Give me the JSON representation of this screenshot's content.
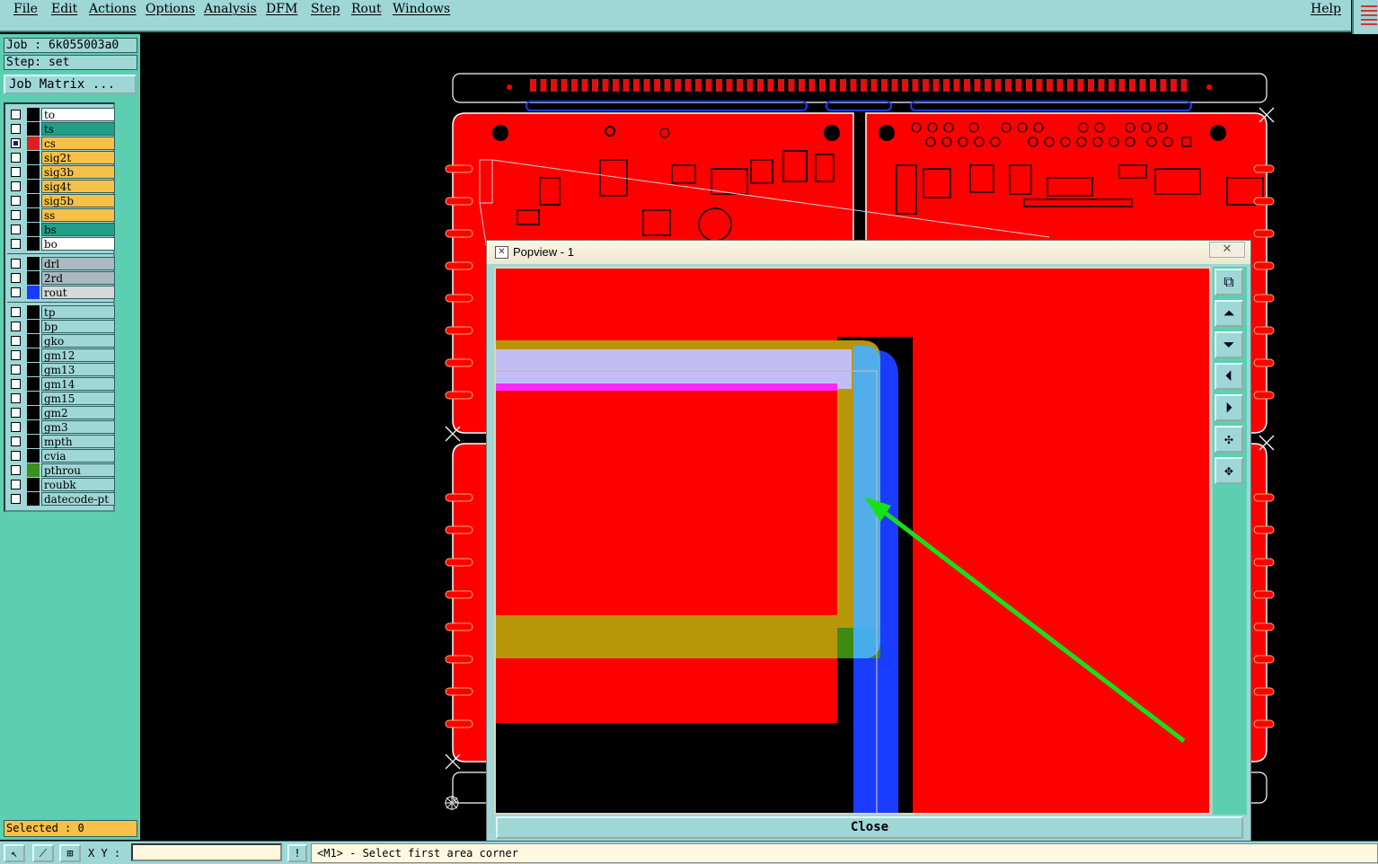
{
  "menu": {
    "items": [
      "File",
      "Edit",
      "Actions",
      "Options",
      "Analysis",
      "DFM",
      "Step",
      "Rout",
      "Windows"
    ],
    "help": "Help"
  },
  "left_panel": {
    "job": "Job : 6k055003a0",
    "step": "Step: set",
    "job_matrix_button": "Job Matrix ...",
    "selected": "Selected : 0",
    "layers_group1": [
      {
        "name": "to",
        "color": "#ffffff",
        "swatch": "#000000"
      },
      {
        "name": "ts",
        "color": "#20a088",
        "swatch": "#000000"
      },
      {
        "name": "cs",
        "color": "#f7c046",
        "swatch": "#e02020",
        "active": true
      },
      {
        "name": "sig2t",
        "color": "#f7c046",
        "swatch": "#000000"
      },
      {
        "name": "sig3b",
        "color": "#f7c046",
        "swatch": "#000000"
      },
      {
        "name": "sig4t",
        "color": "#f7c046",
        "swatch": "#000000"
      },
      {
        "name": "sig5b",
        "color": "#f7c046",
        "swatch": "#000000"
      },
      {
        "name": "ss",
        "color": "#f7c046",
        "swatch": "#000000"
      },
      {
        "name": "bs",
        "color": "#20a088",
        "swatch": "#000000"
      },
      {
        "name": "bo",
        "color": "#ffffff",
        "swatch": "#000000"
      }
    ],
    "layers_group2": [
      {
        "name": "drl",
        "color": "#aab8c0",
        "swatch": "#000000"
      },
      {
        "name": "2rd",
        "color": "#aab8c0",
        "swatch": "#000000"
      },
      {
        "name": "rout",
        "color": "#d8d8d8",
        "swatch": "#1a3cff"
      }
    ],
    "layers_group3": [
      {
        "name": "tp",
        "color": "#9fd6d6",
        "swatch": "#000000"
      },
      {
        "name": "bp",
        "color": "#9fd6d6",
        "swatch": "#000000"
      },
      {
        "name": "gko",
        "color": "#9fd6d6",
        "swatch": "#000000"
      },
      {
        "name": "gm12",
        "color": "#9fd6d6",
        "swatch": "#000000"
      },
      {
        "name": "gm13",
        "color": "#9fd6d6",
        "swatch": "#000000"
      },
      {
        "name": "gm14",
        "color": "#9fd6d6",
        "swatch": "#000000"
      },
      {
        "name": "gm15",
        "color": "#9fd6d6",
        "swatch": "#000000"
      },
      {
        "name": "gm2",
        "color": "#9fd6d6",
        "swatch": "#000000"
      },
      {
        "name": "gm3",
        "color": "#9fd6d6",
        "swatch": "#000000"
      },
      {
        "name": "mpth",
        "color": "#9fd6d6",
        "swatch": "#000000"
      },
      {
        "name": "cvia",
        "color": "#9fd6d6",
        "swatch": "#000000"
      },
      {
        "name": "pthrou",
        "color": "#9fd6d6",
        "swatch": "#3a8f20"
      },
      {
        "name": "roubk",
        "color": "#9fd6d6",
        "swatch": "#000000"
      },
      {
        "name": "datecode-pt",
        "color": "#9fd6d6",
        "swatch": "#000000"
      }
    ]
  },
  "popview": {
    "title": "Popview - 1",
    "close_label": "Close",
    "close_x": "✕"
  },
  "status": {
    "xy_label": "X Y :",
    "exclaim": "!",
    "prompt": "<M1> - Select first area corner"
  },
  "colors": {
    "panel_bg": "#5ccfb0",
    "widget_bg": "#9fd6d6",
    "copper": "#ff0000",
    "rout": "#1a3cff",
    "highlight_arrow": "#18e018"
  }
}
